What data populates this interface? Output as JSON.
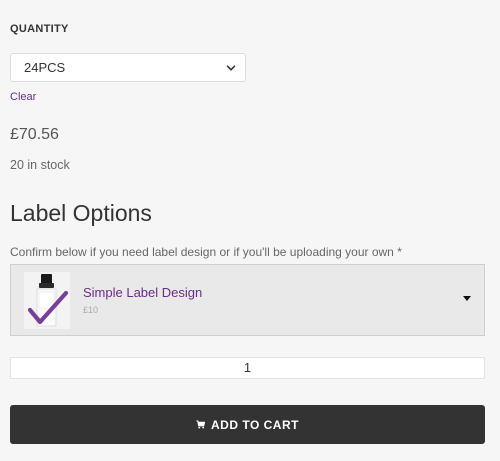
{
  "quantity": {
    "label": "QUANTITY",
    "selected": "24PCS",
    "clear_label": "Clear"
  },
  "product": {
    "price": "£70.56",
    "stock": "20 in stock"
  },
  "label_options": {
    "title": "Label Options",
    "prompt": "Confirm below if you need label design or if you'll be uploading your own *",
    "selected_option": {
      "name": "Simple Label Design",
      "price": "£10"
    }
  },
  "cart": {
    "quantity_value": "1",
    "add_button_label": "ADD TO CART"
  },
  "colors": {
    "accent": "#6a2c86",
    "button_bg": "#333333",
    "page_bg": "#f6f6f6"
  }
}
